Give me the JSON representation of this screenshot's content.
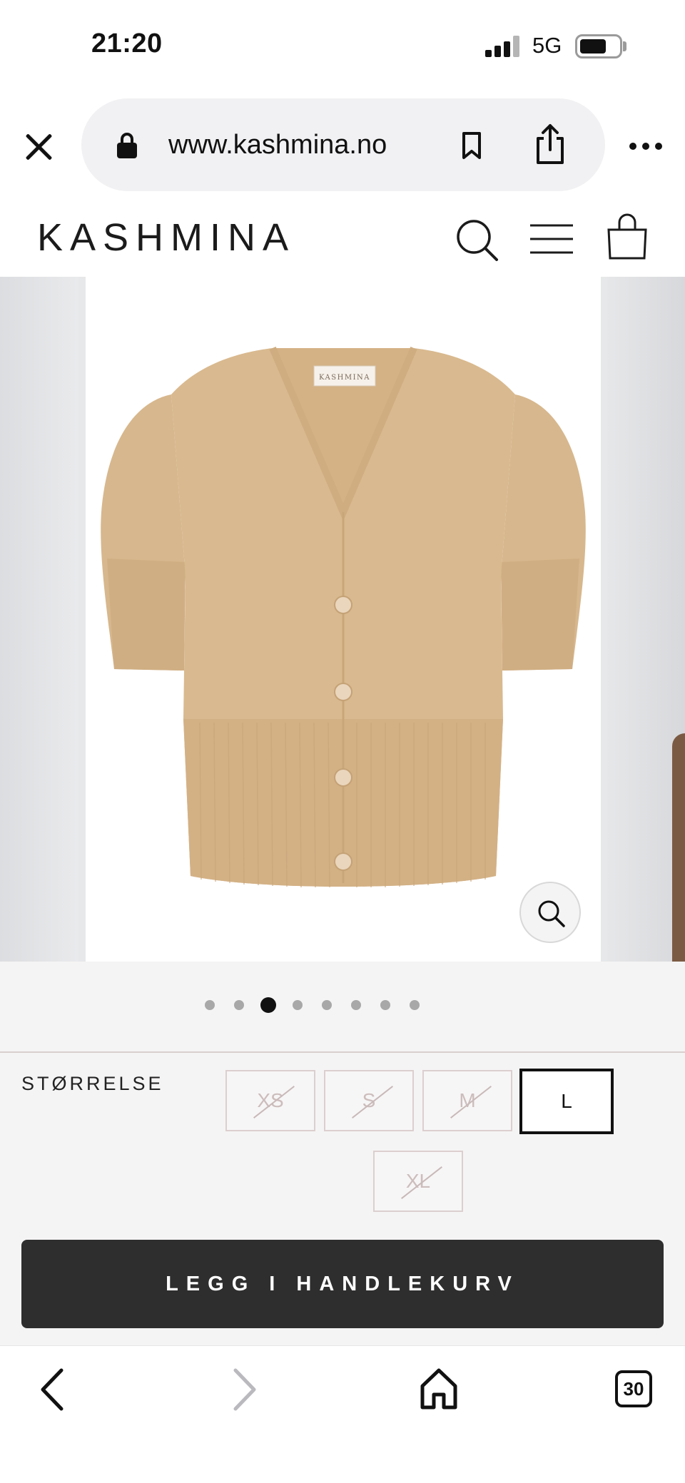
{
  "status_bar": {
    "time": "21:20",
    "network": "5G"
  },
  "browser": {
    "url": "www.kashmina.no",
    "tabs_count": "30"
  },
  "site": {
    "logo": "KASHMINA"
  },
  "product": {
    "image_label_text": "KASHMINA",
    "gallery_dots": 8,
    "active_dot_index": 2
  },
  "size_selector": {
    "label": "STØRRELSE",
    "sizes": [
      {
        "label": "XS",
        "available": false,
        "selected": false
      },
      {
        "label": "S",
        "available": false,
        "selected": false
      },
      {
        "label": "M",
        "available": false,
        "selected": false
      },
      {
        "label": "L",
        "available": true,
        "selected": true
      },
      {
        "label": "XL",
        "available": false,
        "selected": false
      }
    ]
  },
  "cart": {
    "add_button_label": "LEGG I HANDLEKURV"
  },
  "colors": {
    "garment": "#d9b98f",
    "button_dark": "#2e2e2e",
    "panel_bg": "#f5f4f4"
  }
}
